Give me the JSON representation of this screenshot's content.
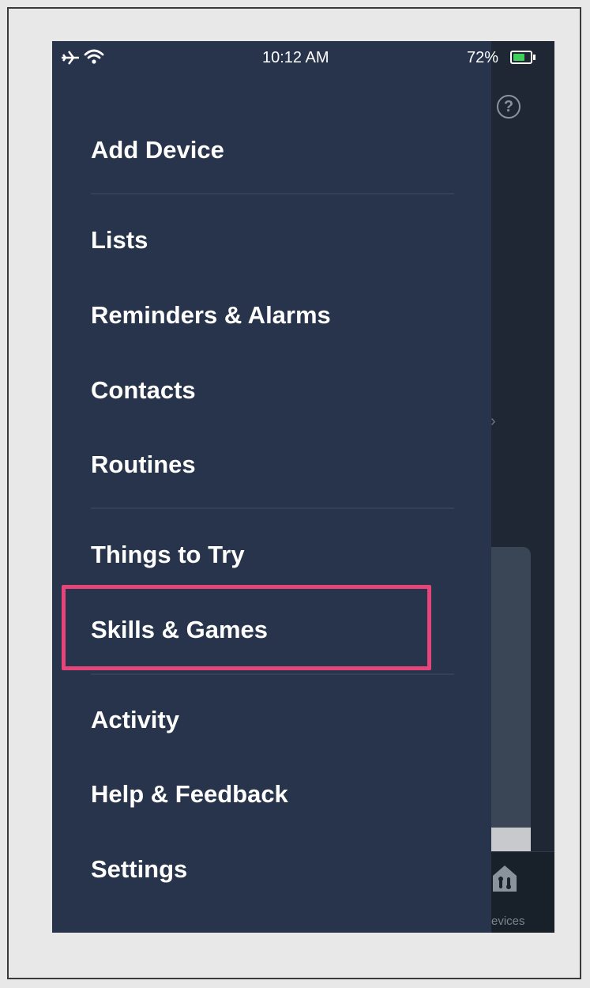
{
  "status_bar": {
    "left_icons": [
      "airplane-icon",
      "wifi-icon"
    ],
    "time": "10:12 AM",
    "battery_percent": "72%",
    "battery_level": 0.72,
    "battery_charging": true,
    "battery_color": "#3fcf5a"
  },
  "background": {
    "help_icon_glyph": "?",
    "chevron_glyph": "›",
    "tab_label": "evices"
  },
  "menu": {
    "items": [
      {
        "label": "Add Device"
      },
      {
        "label": "Lists"
      },
      {
        "label": "Reminders & Alarms"
      },
      {
        "label": "Contacts"
      },
      {
        "label": "Routines"
      },
      {
        "label": "Things to Try"
      },
      {
        "label": "Skills & Games",
        "highlighted": true
      },
      {
        "label": "Activity"
      },
      {
        "label": "Help & Feedback"
      },
      {
        "label": "Settings"
      }
    ]
  },
  "colors": {
    "drawer_bg": "#27344b",
    "highlight_border": "#e6457a",
    "text": "#ffffff"
  }
}
